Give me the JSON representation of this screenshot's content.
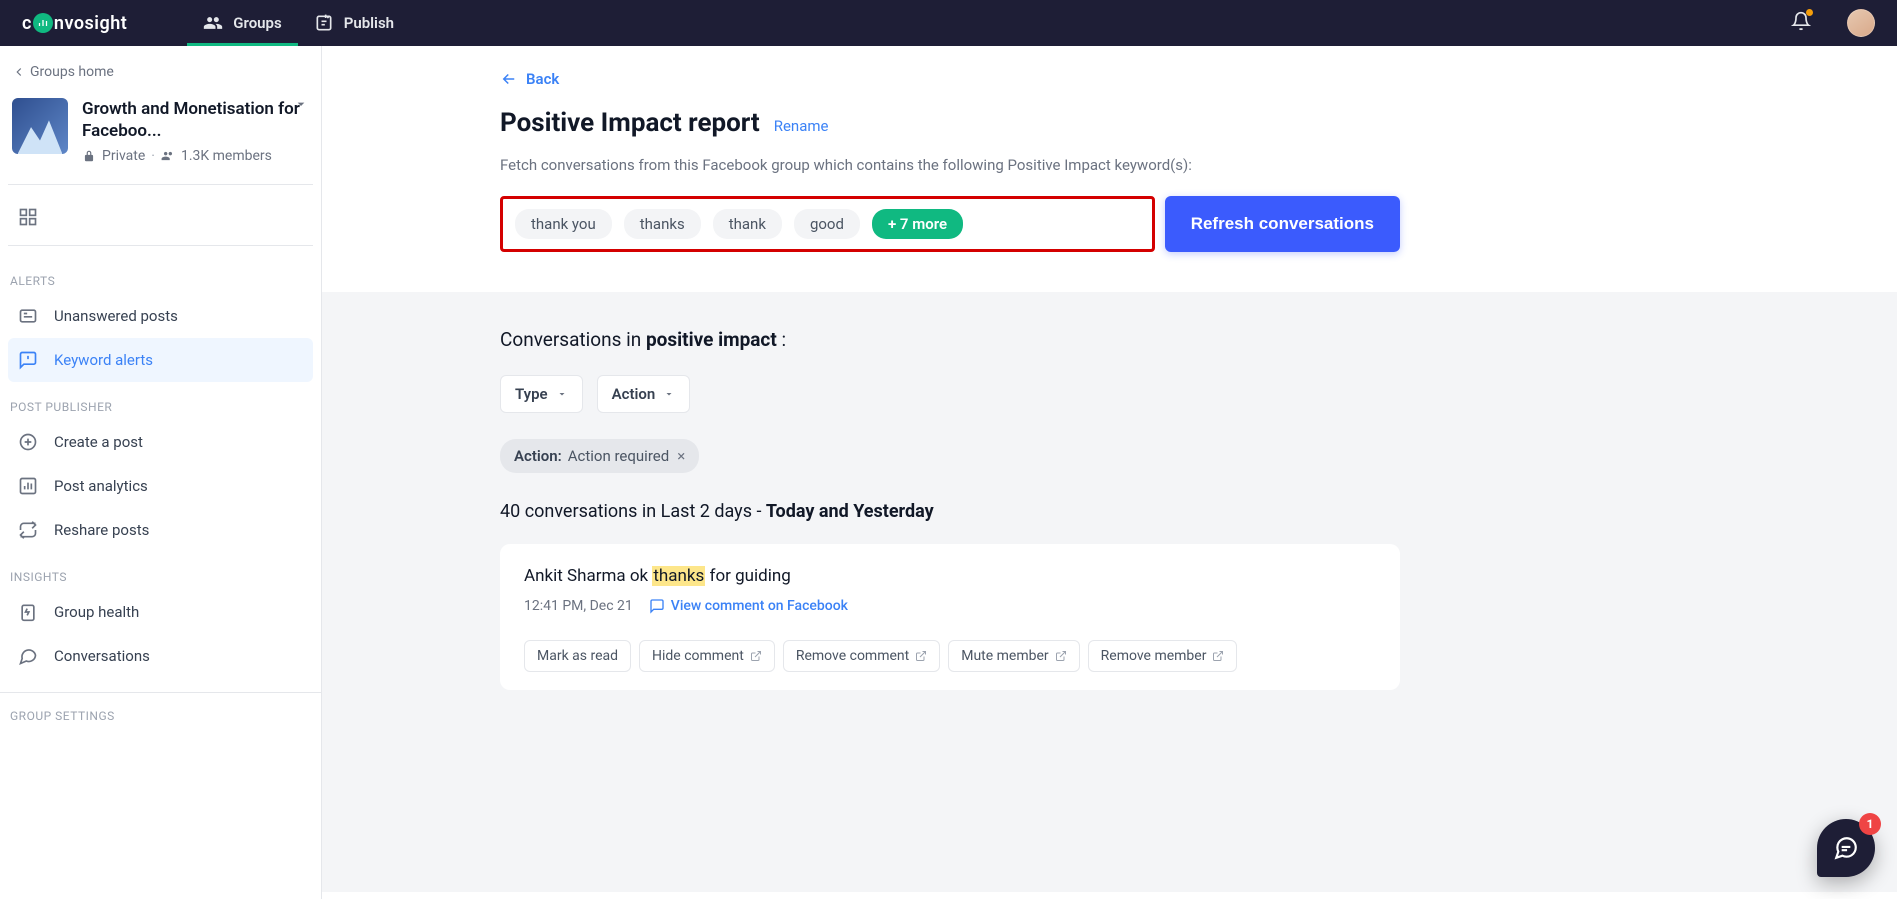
{
  "brand": {
    "pre": "c",
    "post": "nvosight"
  },
  "nav": {
    "groups": "Groups",
    "publish": "Publish"
  },
  "sidebar": {
    "crumb": "Groups home",
    "group_title": "Growth and Monetisation for Faceboo...",
    "privacy": "Private",
    "members": "1.3K members",
    "overview": "Overview",
    "sections": {
      "alerts": "ALERTS",
      "unanswered": "Unanswered posts",
      "keyword": "Keyword alerts",
      "publisher": "POST PUBLISHER",
      "create": "Create a post",
      "analytics": "Post analytics",
      "reshare": "Reshare posts",
      "insights": "INSIGHTS",
      "health": "Group health",
      "conversations": "Conversations",
      "settings": "GROUP SETTINGS"
    }
  },
  "back": "Back",
  "title": "Positive Impact report",
  "rename": "Rename",
  "desc": "Fetch conversations from this Facebook group which contains the following Positive Impact keyword(s):",
  "keywords": [
    "thank you",
    "thanks",
    "thank",
    "good"
  ],
  "more": "+ 7 more",
  "refresh": "Refresh conversations",
  "conv_in_pre": "Conversations in ",
  "conv_in_bold": "positive impact",
  "conv_in_post": " :",
  "filters": {
    "type": "Type",
    "action": "Action"
  },
  "applied": {
    "key": "Action:",
    "val": "Action required",
    "x": "×"
  },
  "count_pre": "40 conversations in Last 2 days - ",
  "count_bold": "Today and Yesterday",
  "comment": {
    "pre": "Ankit Sharma ok ",
    "hl": "thanks",
    "post": " for guiding"
  },
  "timestamp": "12:41 PM, Dec 21",
  "view_link": "View comment on Facebook",
  "actions": {
    "mark": "Mark as read",
    "hide": "Hide comment",
    "remove_c": "Remove comment",
    "mute": "Mute member",
    "remove_m": "Remove member"
  },
  "fab_badge": "1"
}
